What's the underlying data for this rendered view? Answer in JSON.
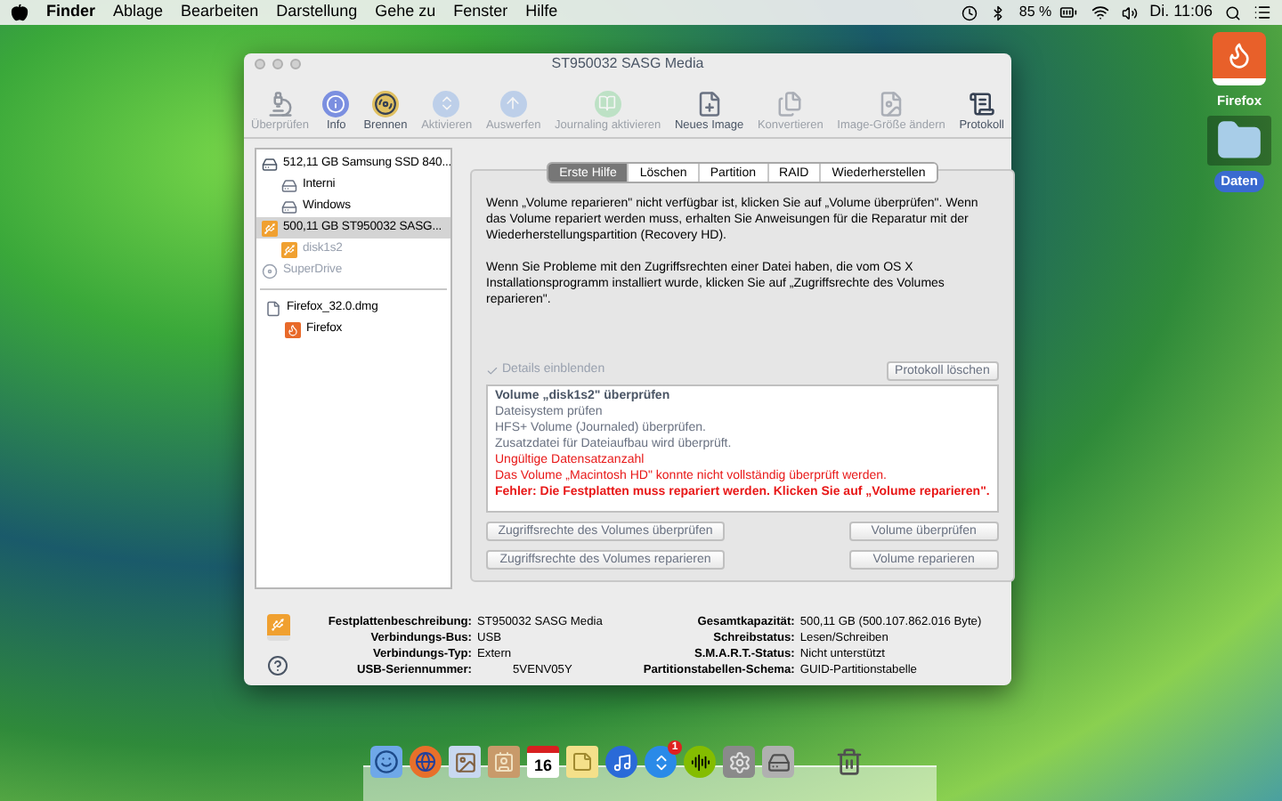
{
  "menubar": {
    "items": [
      {
        "label": "Finder",
        "bold": true
      },
      {
        "label": "Ablage",
        "bold": false
      },
      {
        "label": "Bearbeiten",
        "bold": false
      },
      {
        "label": "Darstellung",
        "bold": false
      },
      {
        "label": "Gehe zu",
        "bold": false
      },
      {
        "label": "Fenster",
        "bold": false
      },
      {
        "label": "Hilfe",
        "bold": false
      }
    ],
    "battery": "85 %",
    "clock": "Di. 11:06"
  },
  "window": {
    "title": "ST950032 SASG Media",
    "toolbar": [
      {
        "label": "Überprüfen",
        "disabled": true
      },
      {
        "label": "Info",
        "disabled": false
      },
      {
        "label": "Brennen",
        "disabled": false
      },
      {
        "label": "Aktivieren",
        "disabled": true
      },
      {
        "label": "Auswerfen",
        "disabled": true
      },
      {
        "label": "Journaling aktivieren",
        "disabled": true
      },
      {
        "label": "Neues Image",
        "disabled": false
      },
      {
        "label": "Konvertieren",
        "disabled": true
      },
      {
        "label": "Image-Größe ändern",
        "disabled": true
      },
      {
        "label": "Protokoll",
        "disabled": false
      }
    ],
    "sidebar": {
      "groups": [
        [
          {
            "label": "512,11 GB Samsung SSD 840...",
            "kind": "disk",
            "selected": false,
            "disabled": false,
            "children": [
              {
                "label": "Interni",
                "kind": "volume",
                "selected": false,
                "disabled": false
              },
              {
                "label": "Windows",
                "kind": "volume",
                "selected": false,
                "disabled": false
              }
            ]
          },
          {
            "label": "500,11 GB ST950032 SASG...",
            "kind": "usb-disk",
            "selected": true,
            "disabled": false,
            "children": [
              {
                "label": "disk1s2",
                "kind": "usb-disk",
                "selected": false,
                "disabled": true
              }
            ]
          },
          {
            "label": "SuperDrive",
            "kind": "optical",
            "selected": false,
            "disabled": true
          }
        ],
        [
          {
            "label": "Firefox_32.0.dmg",
            "kind": "image",
            "selected": false,
            "disabled": false,
            "children": [
              {
                "label": "Firefox",
                "kind": "app-volume",
                "selected": false,
                "disabled": false
              }
            ]
          }
        ]
      ]
    },
    "tabs": [
      {
        "label": "Erste Hilfe",
        "selected": true
      },
      {
        "label": "Löschen",
        "selected": false
      },
      {
        "label": "Partition",
        "selected": false
      },
      {
        "label": "RAID",
        "selected": false
      },
      {
        "label": "Wiederherstellen",
        "selected": false
      }
    ],
    "paragraphs": [
      "Wenn „Volume reparieren\" nicht verfügbar ist, klicken Sie auf „Volume überprüfen\". Wenn das Volume repariert werden muss, erhalten Sie Anweisungen für die Reparatur mit der Wiederherstellungspartition (Recovery HD).",
      "Wenn Sie Probleme mit den Zugriffsrechten einer Datei haben, die vom OS X Installationsprogramm installiert wurde, klicken Sie auf „Zugriffsrechte des Volumes reparieren\"."
    ],
    "details": {
      "label": "Details einblenden",
      "checked": true,
      "disabled": true
    },
    "clear_log_button": "Protokoll löschen",
    "log": [
      {
        "text": "Volume „disk1s2\" überprüfen",
        "kind": "heading"
      },
      {
        "text": "Dateisystem prüfen",
        "kind": "normal"
      },
      {
        "text": "HFS+ Volume (Journaled) überprüfen.",
        "kind": "normal"
      },
      {
        "text": "Zusatzdatei für Dateiaufbau wird überprüft.",
        "kind": "normal"
      },
      {
        "text": "Ungültige Datensatzanzahl",
        "kind": "error"
      },
      {
        "text": "Das Volume „Macintosh HD\" konnte nicht vollständig überprüft werden.",
        "kind": "error"
      },
      {
        "text": "Fehler: Die Festplatten muss repariert werden. Klicken Sie auf „Volume reparieren\".",
        "kind": "fatal"
      }
    ],
    "buttons": [
      {
        "label": "Zugriffsrechte des Volumes überprüfen"
      },
      {
        "label": "Volume überprüfen"
      },
      {
        "label": "Zugriffsrechte des Volumes reparieren"
      },
      {
        "label": "Volume reparieren"
      }
    ],
    "info_left": [
      {
        "label": "Festplattenbeschreibung:",
        "value": "ST950032 SASG Media"
      },
      {
        "label": "Verbindungs-Bus:",
        "value": "USB"
      },
      {
        "label": "Verbindungs-Typ:",
        "value": "Extern"
      },
      {
        "label": "USB-Seriennummer:",
        "value": "5VENV05Y"
      }
    ],
    "info_right": [
      {
        "label": "Gesamtkapazität:",
        "value": "500,11 GB (500.107.862.016 Byte)"
      },
      {
        "label": "Schreibstatus:",
        "value": "Lesen/Schreiben"
      },
      {
        "label": "S.M.A.R.T.-Status:",
        "value": "Nicht unterstützt"
      },
      {
        "label": "Partitionstabellen-Schema:",
        "value": "GUID-Partitionstabelle"
      }
    ]
  },
  "desktop_icons": [
    {
      "label": "Firefox",
      "selected": false
    },
    {
      "label": "Daten",
      "selected": true
    }
  ],
  "dock": {
    "calendar_day": "16",
    "app_store_badge": "1"
  }
}
